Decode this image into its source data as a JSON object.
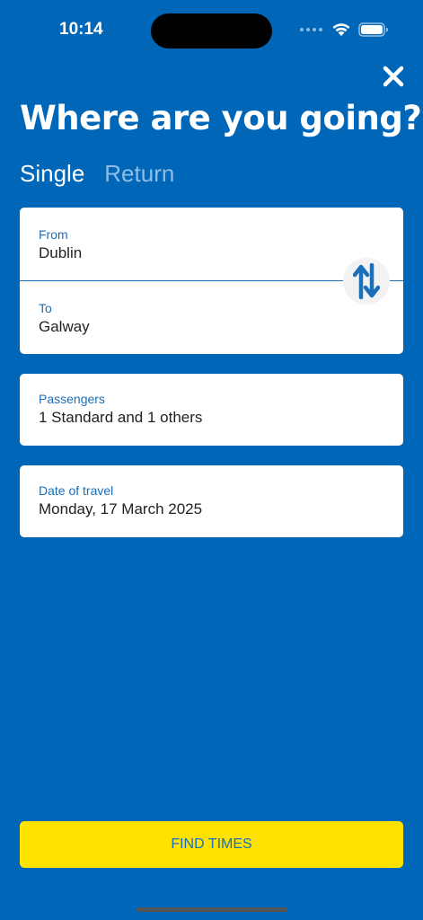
{
  "status_bar": {
    "time": "10:14"
  },
  "header": {
    "title": "Where are you going?"
  },
  "tabs": [
    {
      "label": "Single",
      "active": true
    },
    {
      "label": "Return",
      "active": false
    }
  ],
  "route": {
    "from": {
      "label": "From",
      "value": "Dublin"
    },
    "to": {
      "label": "To",
      "value": "Galway"
    }
  },
  "passengers": {
    "label": "Passengers",
    "value": "1 Standard and 1 others"
  },
  "date": {
    "label": "Date of travel",
    "value": "Monday, 17 March 2025"
  },
  "actions": {
    "find_label": "FIND TIMES"
  },
  "icons": {
    "close": "close-icon",
    "swap": "swap-vertical-icon",
    "wifi": "wifi-icon",
    "battery": "battery-icon"
  },
  "colors": {
    "background": "#0067b8",
    "accent": "#ffe200",
    "link": "#1a6fb8"
  }
}
